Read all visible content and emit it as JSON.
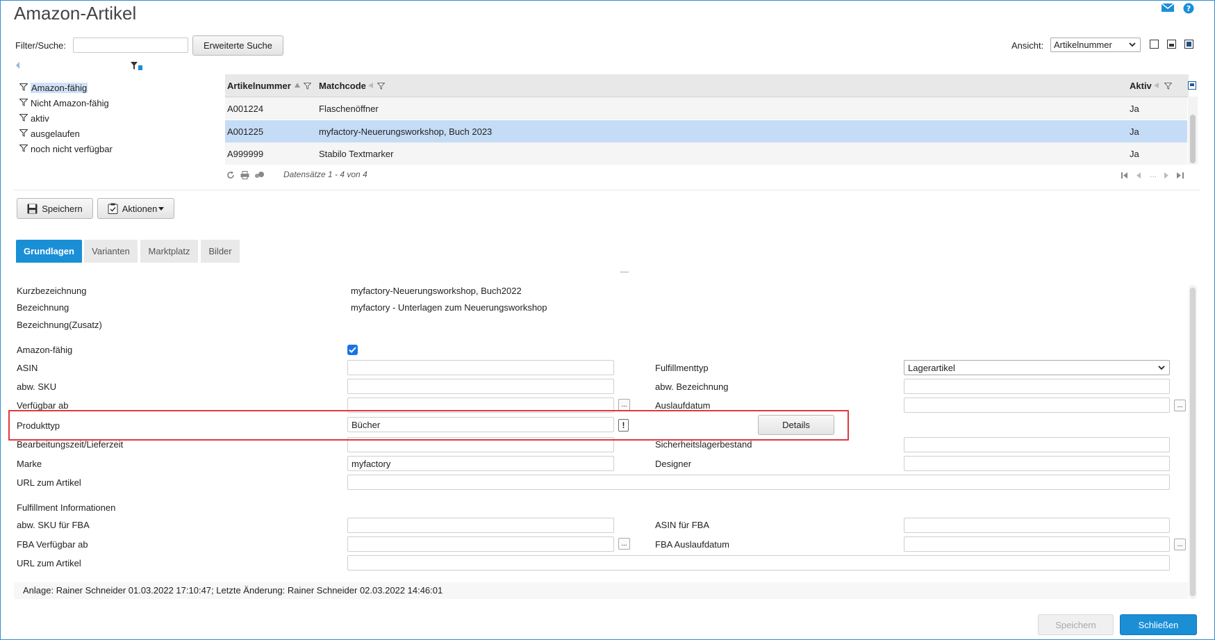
{
  "page": {
    "title": "Amazon-Artikel"
  },
  "toolbar": {
    "filter_label": "Filter/Suche:",
    "filter_value": "",
    "advanced_search_label": "Erweiterte Suche",
    "view_label": "Ansicht:",
    "view_selected": "Artikelnummer"
  },
  "filters": [
    {
      "label": "Amazon-fähig",
      "selected": true
    },
    {
      "label": "Nicht Amazon-fähig"
    },
    {
      "label": "aktiv"
    },
    {
      "label": "ausgelaufen"
    },
    {
      "label": "noch nicht verfügbar"
    }
  ],
  "grid": {
    "columns": [
      "Artikelnummer",
      "Matchcode",
      "Aktiv"
    ],
    "rows": [
      {
        "artikelnummer": "A001224",
        "matchcode": "Flaschenöffner",
        "aktiv": "Ja",
        "selected": false
      },
      {
        "artikelnummer": "A001225",
        "matchcode": "myfactory-Neuerungsworkshop, Buch 2023",
        "aktiv": "Ja",
        "selected": true
      },
      {
        "artikelnummer": "A999999",
        "matchcode": "Stabilo Textmarker",
        "aktiv": "Ja",
        "selected": false
      }
    ],
    "records_info": "Datensätze 1 - 4 von 4",
    "pager_ellipsis": "..."
  },
  "actions": {
    "save_label": "Speichern",
    "actions_label": "Aktionen"
  },
  "tabs": [
    {
      "label": "Grundlagen",
      "active": true
    },
    {
      "label": "Varianten"
    },
    {
      "label": "Marktplatz"
    },
    {
      "label": "Bilder"
    }
  ],
  "form": {
    "kurzbezeichnung": {
      "label": "Kurzbezeichnung",
      "value": "myfactory-Neuerungsworkshop, Buch2022"
    },
    "bezeichnung": {
      "label": "Bezeichnung",
      "value": "myfactory - Unterlagen zum Neuerungsworkshop"
    },
    "bezeichnung_zusatz": {
      "label": "Bezeichnung(Zusatz)",
      "value": ""
    },
    "amazon_faehig": {
      "label": "Amazon-fähig",
      "checked": true
    },
    "asin": {
      "label": "ASIN",
      "value": ""
    },
    "abw_sku": {
      "label": "abw. SKU",
      "value": ""
    },
    "verfuegbar_ab": {
      "label": "Verfügbar ab",
      "value": ""
    },
    "produkttyp": {
      "label": "Produkttyp",
      "value": "Bücher",
      "details_label": "Details"
    },
    "bearbeitungszeit": {
      "label": "Bearbeitungszeit/Lieferzeit",
      "value": ""
    },
    "marke": {
      "label": "Marke",
      "value": "myfactory"
    },
    "url_artikel": {
      "label": "URL zum Artikel",
      "value": ""
    },
    "fulfillmenttyp": {
      "label": "Fulfillmenttyp",
      "value": "Lagerartikel"
    },
    "abw_bezeichnung": {
      "label": "abw. Bezeichnung",
      "value": ""
    },
    "auslaufdatum": {
      "label": "Auslaufdatum",
      "value": ""
    },
    "sicherheitslagerbestand": {
      "label": "Sicherheitslagerbestand",
      "value": ""
    },
    "designer": {
      "label": "Designer",
      "value": ""
    },
    "fulfillment_section": "Fulfillment Informationen",
    "abw_sku_fba": {
      "label": "abw. SKU für FBA",
      "value": ""
    },
    "fba_verfuegbar_ab": {
      "label": "FBA Verfügbar ab",
      "value": ""
    },
    "url_artikel_fba": {
      "label": "URL zum Artikel",
      "value": ""
    },
    "asin_fba": {
      "label": "ASIN für FBA",
      "value": ""
    },
    "fba_auslaufdatum": {
      "label": "FBA Auslaufdatum",
      "value": ""
    },
    "dots_label": "...",
    "excl_label": "!"
  },
  "audit": "Anlage: Rainer Schneider 01.03.2022 17:10:47; Letzte Änderung: Rainer Schneider 02.03.2022 14:46:01",
  "footer": {
    "save_label": "Speichern",
    "close_label": "Schließen"
  },
  "colors": {
    "accent": "#1a8fd6",
    "selected_row": "#c5dcf6",
    "highlight_border": "#e0383e"
  }
}
